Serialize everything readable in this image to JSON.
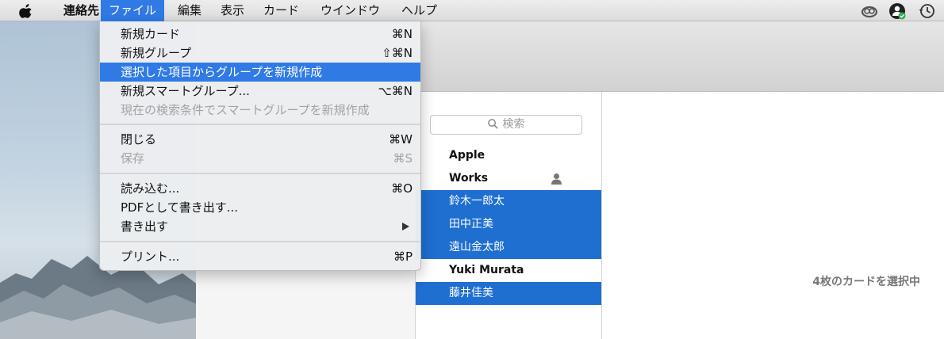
{
  "menubar": {
    "app_name": "連絡先",
    "items": [
      "ファイル",
      "編集",
      "表示",
      "カード",
      "ウインドウ",
      "ヘルプ"
    ],
    "active_item": "ファイル"
  },
  "file_menu": {
    "items": [
      {
        "label": "新規カード",
        "shortcut": "⌘N",
        "state": "enabled"
      },
      {
        "label": "新規グループ",
        "shortcut": "⇧⌘N",
        "state": "enabled"
      },
      {
        "label": "選択した項目からグループを新規作成",
        "shortcut": "",
        "state": "highlighted"
      },
      {
        "label": "新規スマートグループ...",
        "shortcut": "⌥⌘N",
        "state": "enabled"
      },
      {
        "label": "現在の検索条件でスマートグループを新規作成",
        "shortcut": "",
        "state": "disabled"
      },
      {
        "label": "閉じる",
        "shortcut": "⌘W",
        "state": "enabled"
      },
      {
        "label": "保存",
        "shortcut": "⌘S",
        "state": "disabled"
      },
      {
        "label": "読み込む...",
        "shortcut": "⌘O",
        "state": "enabled"
      },
      {
        "label": "PDFとして書き出す...",
        "shortcut": "",
        "state": "enabled"
      },
      {
        "label": "書き出す",
        "shortcut": "",
        "state": "submenu"
      },
      {
        "label": "プリント...",
        "shortcut": "⌘P",
        "state": "enabled"
      }
    ]
  },
  "contacts": {
    "search_placeholder": "検索",
    "rows": [
      {
        "name": "Apple",
        "style": "header"
      },
      {
        "name": "Works",
        "style": "header"
      },
      {
        "name": "鈴木一郎太",
        "style": "selected"
      },
      {
        "name": "田中正美",
        "style": "selected"
      },
      {
        "name": "遠山金太郎",
        "style": "selected"
      },
      {
        "name": "Yuki Murata",
        "style": "bold"
      },
      {
        "name": "藤井佳美",
        "style": "selected"
      }
    ],
    "selection_count_text": "4枚のカードを選択中"
  },
  "icons": {
    "apple": "apple-logo-icon",
    "status": [
      "creative-cloud-icon",
      "user-status-icon",
      "time-machine-icon"
    ],
    "search": "magnifier-icon",
    "person": "person-icon",
    "submenu": "submenu-arrow-icon"
  },
  "colors": {
    "accent": "#2f7ae5",
    "selection": "#1f6fd1",
    "disabled_text": "#a3a3a3"
  }
}
